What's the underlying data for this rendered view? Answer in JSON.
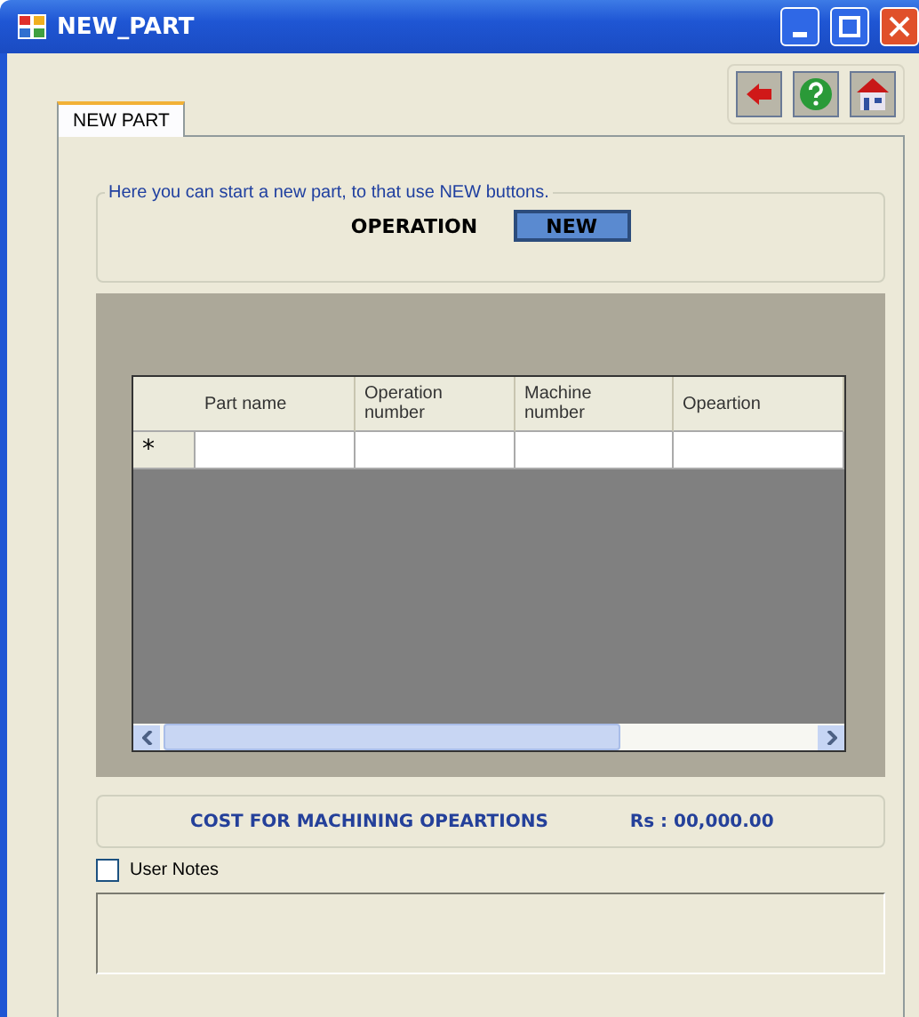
{
  "window": {
    "title": "NEW_PART"
  },
  "tabs": [
    {
      "label": "NEW PART",
      "selected": true
    }
  ],
  "intro": {
    "legend": "Here you can start a new part, to that use NEW buttons.",
    "label": "OPERATION",
    "button": "NEW"
  },
  "table": {
    "columns": [
      "Part name",
      "Operation number",
      "Machine number",
      "Opeartion"
    ],
    "new_row_marker": "*"
  },
  "cost": {
    "label": "COST FOR MACHINING OPEARTIONS",
    "value": "Rs : 00,000.00"
  },
  "user_notes": {
    "label": "User Notes",
    "checked": false
  }
}
